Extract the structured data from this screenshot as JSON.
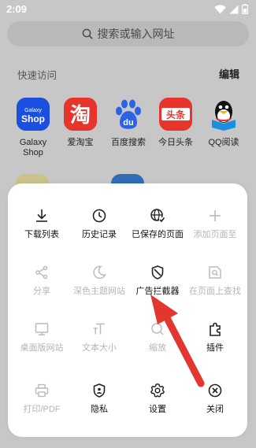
{
  "status": {
    "time": "2:09"
  },
  "search": {
    "placeholder": "搜索或输入网址"
  },
  "quick_access": {
    "title": "快速访问",
    "edit_label": "编辑",
    "tiles": [
      {
        "label": "Galaxy\nShop",
        "icon": "galaxy-shop-icon",
        "bg": "#1a4fe0"
      },
      {
        "label": "爱淘宝",
        "icon": "taobao-icon",
        "bg": "#e8352b"
      },
      {
        "label": "百度搜索",
        "icon": "baidu-icon",
        "bg": "#ffffff"
      },
      {
        "label": "今日头条",
        "icon": "toutiao-icon",
        "bg": "#e8352b"
      },
      {
        "label": "QQ阅读",
        "icon": "qq-reader-icon",
        "bg": "#ffffff"
      }
    ]
  },
  "menu": {
    "items": [
      {
        "label": "下载列表",
        "icon": "download-icon",
        "enabled": true
      },
      {
        "label": "历史记录",
        "icon": "history-clock-icon",
        "enabled": true
      },
      {
        "label": "已保存的页面",
        "icon": "saved-pages-globe-icon",
        "enabled": true
      },
      {
        "label": "添加页面至",
        "icon": "plus-icon",
        "enabled": false
      },
      {
        "label": "分享",
        "icon": "share-icon",
        "enabled": false
      },
      {
        "label": "深色主题网站",
        "icon": "moon-icon",
        "enabled": false
      },
      {
        "label": "广告拦截器",
        "icon": "ad-blocker-shield-icon",
        "enabled": true
      },
      {
        "label": "在页面上查找",
        "icon": "find-in-page-icon",
        "enabled": false
      },
      {
        "label": "桌面版网站",
        "icon": "desktop-icon",
        "enabled": false
      },
      {
        "label": "文本大小",
        "icon": "text-size-icon",
        "enabled": false
      },
      {
        "label": "缩放",
        "icon": "zoom-icon",
        "enabled": false
      },
      {
        "label": "插件",
        "icon": "plugin-icon",
        "enabled": true
      },
      {
        "label": "打印/PDF",
        "icon": "print-icon",
        "enabled": false
      },
      {
        "label": "隐私",
        "icon": "privacy-shield-icon",
        "enabled": true
      },
      {
        "label": "设置",
        "icon": "gear-icon",
        "enabled": true
      },
      {
        "label": "关闭",
        "icon": "close-circle-icon",
        "enabled": true
      }
    ]
  },
  "colors": {
    "annotation_arrow": "#e2362f",
    "disabled_text": "#b4b4b4"
  }
}
